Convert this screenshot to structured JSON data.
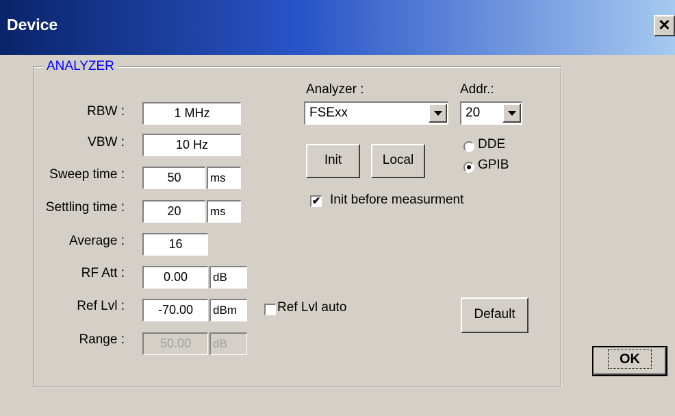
{
  "window": {
    "title": "Device",
    "close_glyph": "✕"
  },
  "group": {
    "label": "ANALYZER"
  },
  "fields": {
    "rbw": {
      "label": "RBW :",
      "value": "1 MHz"
    },
    "vbw": {
      "label": "VBW :",
      "value": "10  Hz"
    },
    "sweep_time": {
      "label": "Sweep time :",
      "value": "50",
      "unit": "ms"
    },
    "settling_time": {
      "label": "Settling time :",
      "value": "20",
      "unit": "ms"
    },
    "average": {
      "label": "Average :",
      "value": "16"
    },
    "rf_att": {
      "label": "RF Att :",
      "value": "0.00",
      "unit": "dB"
    },
    "ref_lvl": {
      "label": "Ref Lvl :",
      "value": "-70.00",
      "unit": "dBm"
    },
    "range": {
      "label": "Range :",
      "value": "50.00",
      "unit": "dB",
      "disabled": true
    }
  },
  "ref_lvl_auto": {
    "label": "Ref Lvl auto",
    "checked": false
  },
  "analyzer": {
    "label": "Analyzer :",
    "selected": "FSExx"
  },
  "addr": {
    "label": "Addr.:",
    "selected": "20"
  },
  "buttons": {
    "init": "Init",
    "local": "Local",
    "default": "Default",
    "ok": "OK"
  },
  "interface": {
    "dde": {
      "label": "DDE",
      "selected": false
    },
    "gpib": {
      "label": "GPIB",
      "selected": true
    }
  },
  "init_before": {
    "label": "Init before measurment",
    "checked": true
  }
}
